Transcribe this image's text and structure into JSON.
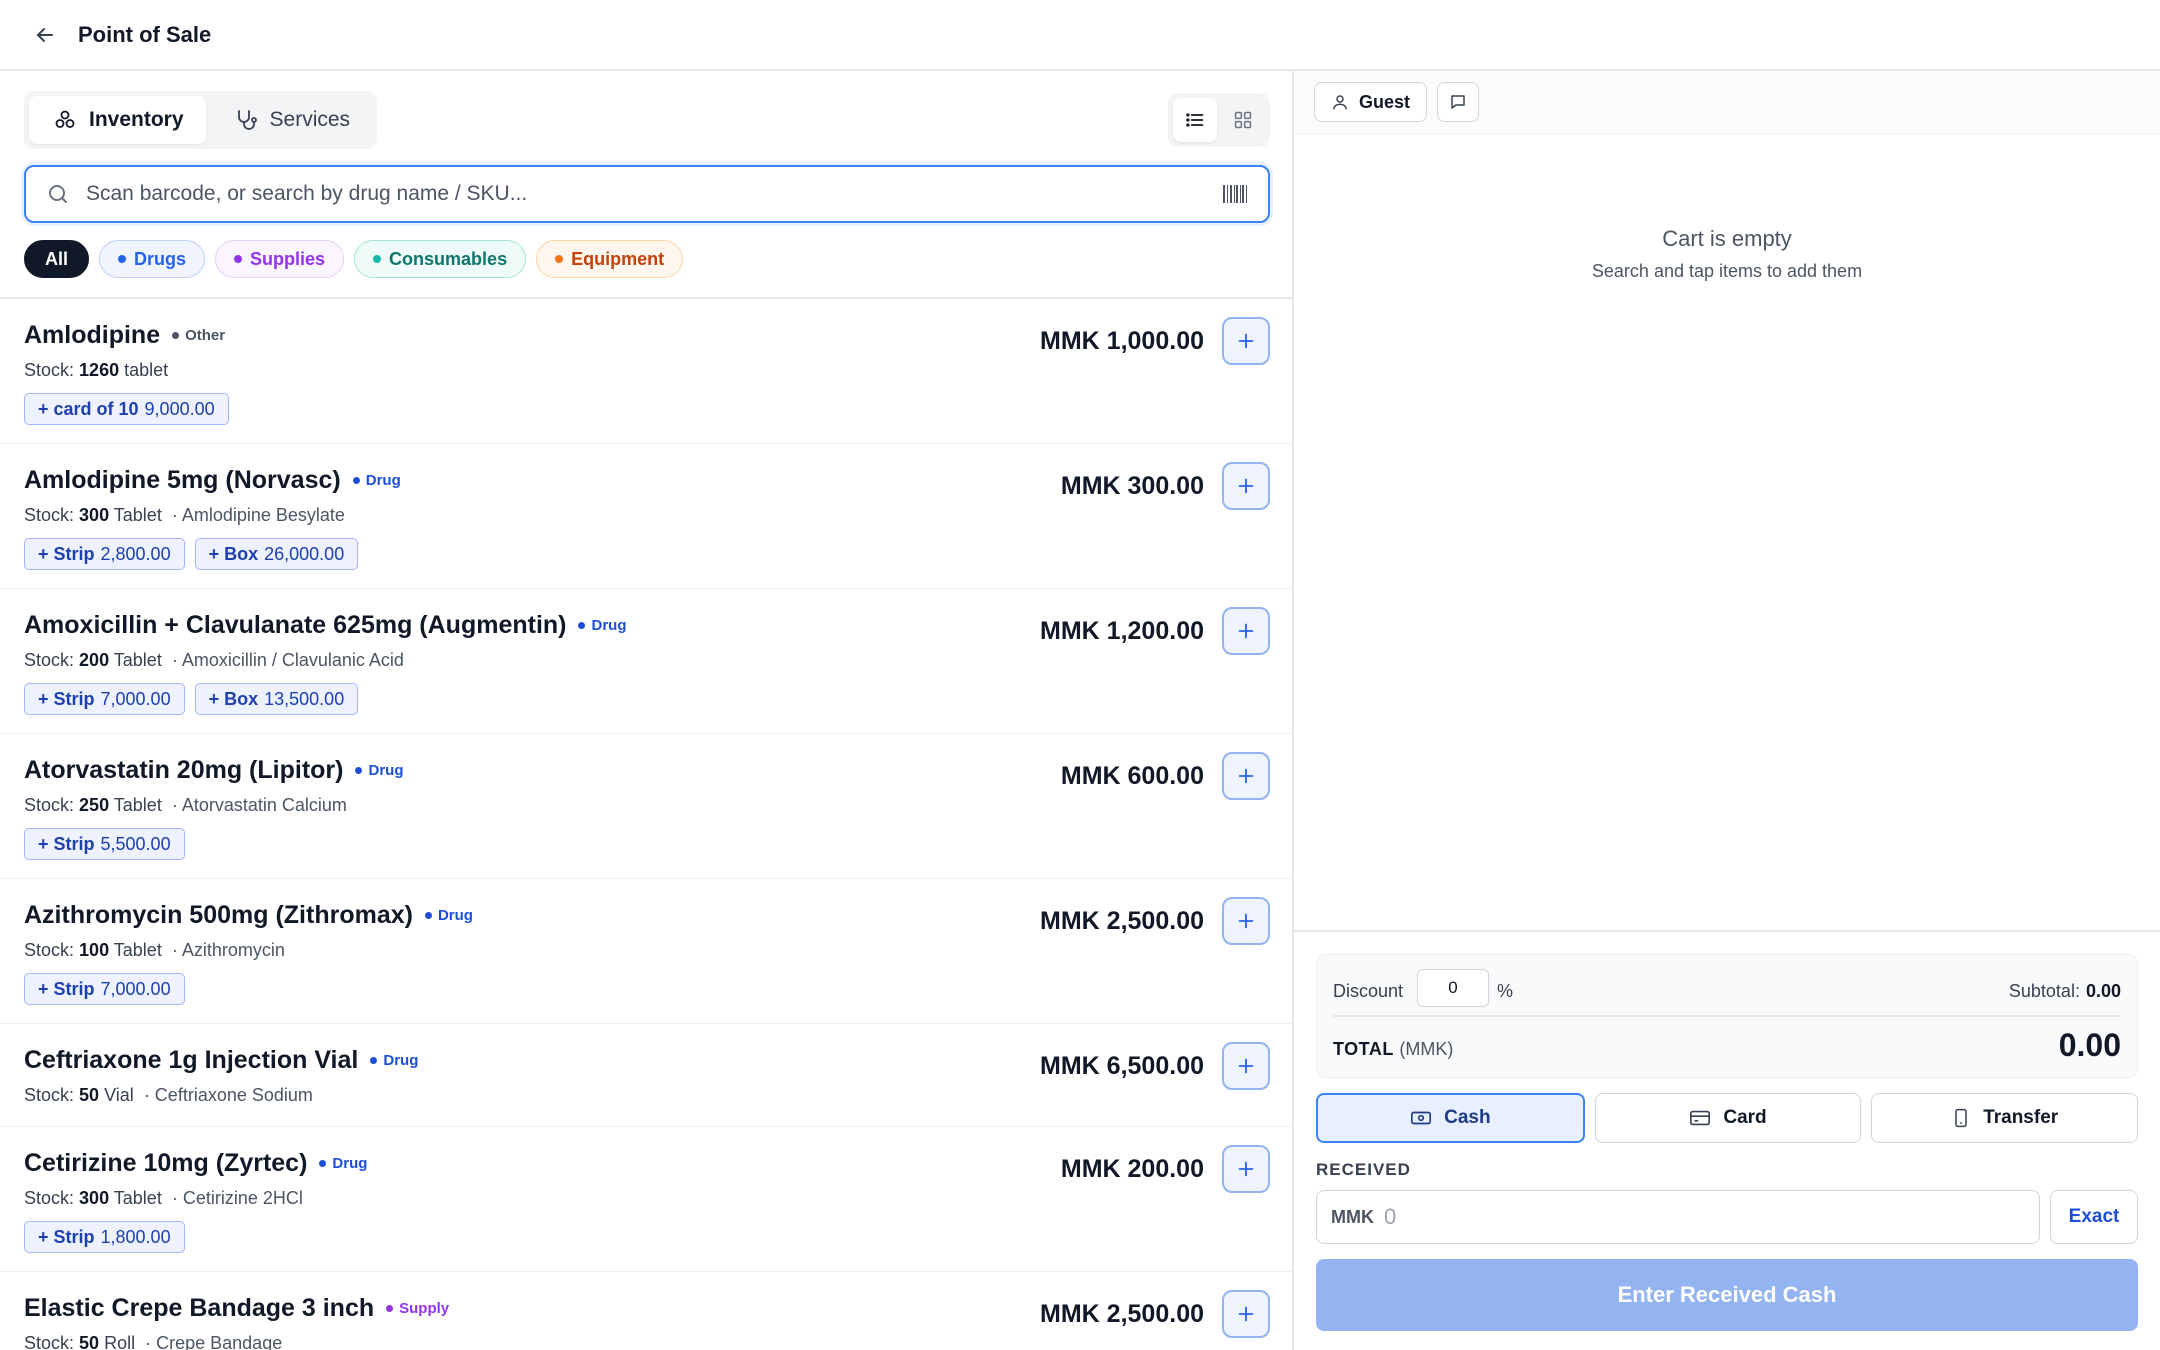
{
  "header": {
    "title": "Point of Sale",
    "back_icon": "arrow-left-icon"
  },
  "tabs": [
    {
      "label": "Inventory",
      "icon": "flask-cluster-icon",
      "active": true
    },
    {
      "label": "Services",
      "icon": "stethoscope-icon",
      "active": false
    }
  ],
  "view_toggle": {
    "active": "list",
    "options": [
      "list-icon",
      "grid-icon"
    ]
  },
  "search": {
    "placeholder": "Scan barcode, or search by drug name / SKU...",
    "value": ""
  },
  "filters": [
    {
      "label": "All",
      "active": true
    },
    {
      "label": "Drugs",
      "color": "#2563eb",
      "bg": "#eff4ff",
      "border": "#bfd2fb"
    },
    {
      "label": "Supplies",
      "color": "#9333ea",
      "bg": "#faf5ff",
      "border": "#e4cffb"
    },
    {
      "label": "Consumables",
      "color": "#0f766e",
      "bg": "#effbf8",
      "border": "#a7e3d6",
      "dot": "#14b8a6"
    },
    {
      "label": "Equipment",
      "color": "#c2410c",
      "bg": "#fff7ed",
      "border": "#fcd3a6",
      "dot": "#f97316"
    }
  ],
  "currency": "MMK",
  "products": [
    {
      "name": "Amlodipine",
      "category": "Other",
      "stock_label": "Stock:",
      "stock_qty": "1260",
      "unit": "tablet",
      "generic": "",
      "price": "MMK 1,000.00",
      "packs": [
        {
          "label": "+ card of 10",
          "price": "9,000.00"
        }
      ]
    },
    {
      "name": "Amlodipine 5mg (Norvasc)",
      "category": "Drug",
      "stock_label": "Stock:",
      "stock_qty": "300",
      "unit": "Tablet",
      "generic": "· Amlodipine Besylate",
      "price": "MMK 300.00",
      "packs": [
        {
          "label": "+ Strip",
          "price": "2,800.00"
        },
        {
          "label": "+ Box",
          "price": "26,000.00"
        }
      ]
    },
    {
      "name": "Amoxicillin + Clavulanate 625mg (Augmentin)",
      "category": "Drug",
      "stock_label": "Stock:",
      "stock_qty": "200",
      "unit": "Tablet",
      "generic": "· Amoxicillin / Clavulanic Acid",
      "price": "MMK 1,200.00",
      "packs": [
        {
          "label": "+ Strip",
          "price": "7,000.00"
        },
        {
          "label": "+ Box",
          "price": "13,500.00"
        }
      ]
    },
    {
      "name": "Atorvastatin 20mg (Lipitor)",
      "category": "Drug",
      "stock_label": "Stock:",
      "stock_qty": "250",
      "unit": "Tablet",
      "generic": "· Atorvastatin Calcium",
      "price": "MMK 600.00",
      "packs": [
        {
          "label": "+ Strip",
          "price": "5,500.00"
        }
      ]
    },
    {
      "name": "Azithromycin 500mg (Zithromax)",
      "category": "Drug",
      "stock_label": "Stock:",
      "stock_qty": "100",
      "unit": "Tablet",
      "generic": "· Azithromycin",
      "price": "MMK 2,500.00",
      "packs": [
        {
          "label": "+ Strip",
          "price": "7,000.00"
        }
      ]
    },
    {
      "name": "Ceftriaxone 1g Injection Vial",
      "category": "Drug",
      "stock_label": "Stock:",
      "stock_qty": "50",
      "unit": "Vial",
      "generic": "· Ceftriaxone Sodium",
      "price": "MMK 6,500.00",
      "packs": []
    },
    {
      "name": "Cetirizine 10mg (Zyrtec)",
      "category": "Drug",
      "stock_label": "Stock:",
      "stock_qty": "300",
      "unit": "Tablet",
      "generic": "· Cetirizine 2HCl",
      "price": "MMK 200.00",
      "packs": [
        {
          "label": "+ Strip",
          "price": "1,800.00"
        }
      ]
    },
    {
      "name": "Elastic Crepe Bandage 3 inch",
      "category": "Supply",
      "stock_label": "Stock:",
      "stock_qty": "50",
      "unit": "Roll",
      "generic": "· Crepe Bandage",
      "price": "MMK 2,500.00",
      "packs": []
    }
  ],
  "category_colors": {
    "Other": "#4b5563",
    "Drug": "#1d4ed8",
    "Supply": "#9333ea"
  },
  "customer": {
    "label": "Guest",
    "icon": "user-icon",
    "note_icon": "message-icon"
  },
  "cart": {
    "empty_title": "Cart is empty",
    "empty_subtitle": "Search and tap items to add them"
  },
  "summary": {
    "discount_label": "Discount",
    "discount_value": "0",
    "discount_unit": "%",
    "subtotal_label": "Subtotal:",
    "subtotal_value": "0.00",
    "total_label": "TOTAL",
    "total_currency": "(MMK)",
    "total_value": "0.00"
  },
  "payment_methods": [
    {
      "label": "Cash",
      "icon": "cash-icon",
      "active": true
    },
    {
      "label": "Card",
      "icon": "credit-card-icon",
      "active": false
    },
    {
      "label": "Transfer",
      "icon": "smartphone-icon",
      "active": false
    }
  ],
  "received": {
    "label": "RECEIVED",
    "currency": "MMK",
    "placeholder": "0",
    "value": "",
    "exact_label": "Exact"
  },
  "submit_label": "Enter Received Cash"
}
